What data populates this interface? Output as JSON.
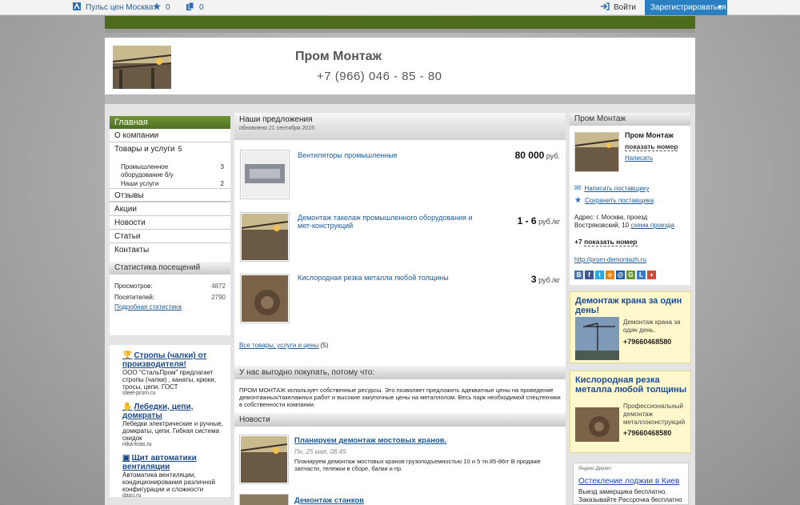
{
  "topbar": {
    "pulse": "Пульс цен Москва",
    "favorites_count": "0",
    "compare_count": "0",
    "login": "Войти",
    "register": "Зарегистрироваться"
  },
  "header": {
    "company_name": "Пром Монтаж",
    "phone": "+7 (966) 046 - 85 - 80"
  },
  "left_nav": {
    "active": "Главная",
    "items": [
      {
        "label": "О компании"
      },
      {
        "label": "Товары и услуги",
        "count": "5"
      }
    ],
    "sub_items": [
      {
        "label": "Промышленное оборудование б/у",
        "count": "3"
      },
      {
        "label": "Наши услуги",
        "count": "2"
      }
    ],
    "items2": [
      "Отзывы",
      "Акции",
      "Новости",
      "Статьи",
      "Контакты"
    ]
  },
  "stats": {
    "title": "Статистика посещений",
    "views_label": "Просмотров:",
    "views_value": "4872",
    "visitors_label": "Посетителей:",
    "visitors_value": "2790",
    "details_link": "Подробная статистика"
  },
  "ads": [
    {
      "title": "Стропы (чалки) от производителя!",
      "text": "ООО \"СтальПром\" предлагает стропы (чалки) , канаты, крюки, тросы, цепи. ГОСТ",
      "domain": "steel-prom.ru"
    },
    {
      "title": "Лебедки, цепи, домкраты",
      "text": "Лебедки электрические и ручные, домкраты, цепи. Гибкая система скидок",
      "domain": "nika-kras.ru"
    },
    {
      "title": "Щит автоматики вентиляции",
      "text": "Автоматика вентиляции, кондиционирования различной конфигурации и сложности",
      "domain": "dasu.ru"
    }
  ],
  "offers": {
    "title": "Наши предложения",
    "updated": "обновлено 21 сентября 2015",
    "items": [
      {
        "name": "Вентиляторы промышленные",
        "price": "80 000",
        "unit": "руб."
      },
      {
        "name": "Демонтаж такелаж промышленного оборудования и мет-конструкций",
        "price": "1 - 6",
        "unit": "руб./кг"
      },
      {
        "name": "Кислородная резка металла любой толщины",
        "price": "3",
        "unit": "руб./кг"
      }
    ],
    "all_link": "Все товары, услуги и цены",
    "all_count": "(5)"
  },
  "why": {
    "title": "У нас выгодно покупать, потому что:",
    "text": "ПРОМ МОНТАЖ использует собственные ресурсы. Это позволяет предложить адекватные цены на проведение демонтажных/такелажных работ и высокие закупочные цены на металлолом. Весь парк необходимой спецтехники в собственности компании."
  },
  "news": {
    "title": "Новости",
    "items": [
      {
        "title": "Планируем демонтаж мостовых кранов.",
        "date": "Пн, 25 мая, 08:49",
        "text": "Планируем демонтаж мостовых кранов грузоподъемностью 10 и 5 тн.85-86гг В продаже запчасти, тележки в сборе, балки и пр."
      },
      {
        "title": "Демонтаж станков"
      }
    ]
  },
  "company_card": {
    "title": "Пром Монтаж",
    "name": "Пром Монтаж",
    "show_phone": "показать номер",
    "write": "Написать",
    "write_supplier": "Написать поставщику",
    "save_supplier": "Сохранить поставщика",
    "address": "Адрес: г. Москва, проезд Востряковский, 10",
    "scheme": "схема проезда",
    "phone_prefix": "+7",
    "phone_show": "показать номер",
    "website": "http://prom-demontazh.ru",
    "social": [
      {
        "t": "B",
        "c": "#4a76a8"
      },
      {
        "t": "f",
        "c": "#3b5998"
      },
      {
        "t": "t",
        "c": "#29a9e1"
      },
      {
        "t": "o",
        "c": "#ee8208"
      },
      {
        "t": "@",
        "c": "#1f5fa8"
      },
      {
        "t": "G",
        "c": "#6a9a2a"
      },
      {
        "t": "L",
        "c": "#3a7bc8"
      },
      {
        "t": "+",
        "c": "#d34836"
      }
    ]
  },
  "promos": [
    {
      "title": "Демонтаж крана за один день!",
      "text": "Демонтаж крана за один день.",
      "phone": "+79660468580"
    },
    {
      "title": "Кислородная резка металла любой толщины",
      "text": "Профессиональный демонтаж металлоконструкций",
      "phone": "+79660468580"
    }
  ],
  "direct": {
    "label": "Яндекс.Директ",
    "title": "Остекление лоджии в Киев",
    "text1": "Выезд замерщика бесплатно.",
    "text2": "Заказывайте Рассрочка бесплатно"
  }
}
